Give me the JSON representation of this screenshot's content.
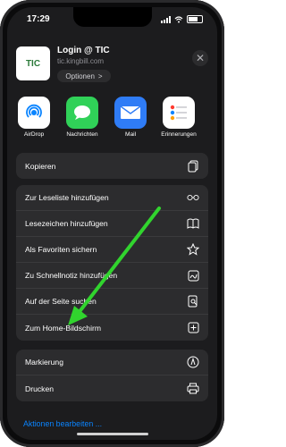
{
  "status": {
    "time": "17:29"
  },
  "header": {
    "thumbnail_text": "TIC",
    "title": "Login @ TIC",
    "url": "tic.kingbill.com",
    "options_label": "Optionen",
    "options_chevron": ">"
  },
  "apps": [
    {
      "label": "AirDrop",
      "icon": "airdrop-icon"
    },
    {
      "label": "Nachrichten",
      "icon": "messages-icon"
    },
    {
      "label": "Mail",
      "icon": "mail-icon"
    },
    {
      "label": "Erinnerungen",
      "icon": "reminders-icon"
    }
  ],
  "groups": [
    {
      "items": [
        {
          "label": "Kopieren",
          "icon": "copy-icon"
        }
      ]
    },
    {
      "items": [
        {
          "label": "Zur Leseliste hinzufügen",
          "icon": "glasses-icon"
        },
        {
          "label": "Lesezeichen hinzufügen",
          "icon": "book-icon"
        },
        {
          "label": "Als Favoriten sichern",
          "icon": "star-icon"
        },
        {
          "label": "Zu Schnellnotiz hinzufügen",
          "icon": "quick-note-icon"
        },
        {
          "label": "Auf der Seite suchen",
          "icon": "find-on-page-icon"
        },
        {
          "label": "Zum Home-Bildschirm",
          "icon": "add-square-icon"
        }
      ]
    },
    {
      "items": [
        {
          "label": "Markierung",
          "icon": "markup-icon"
        },
        {
          "label": "Drucken",
          "icon": "print-icon"
        }
      ]
    }
  ],
  "footer": {
    "edit_actions": "Aktionen bearbeiten ..."
  },
  "colors": {
    "sheet": "#1c1c1e",
    "row": "#2c2c2e",
    "accent": "#0a84ff",
    "arrow": "#31d42e"
  }
}
